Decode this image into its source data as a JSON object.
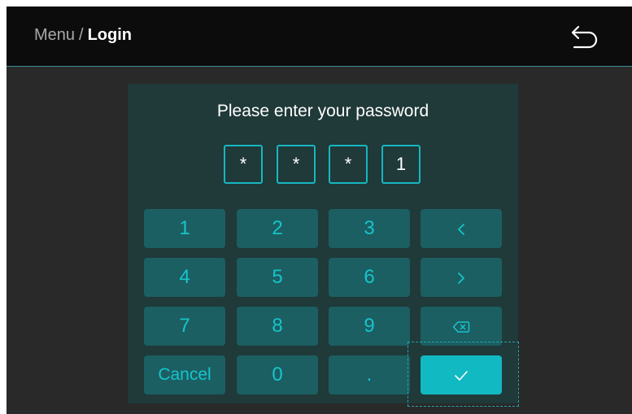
{
  "header": {
    "breadcrumb_parent": "Menu",
    "breadcrumb_separator": "/",
    "breadcrumb_current": "Login",
    "back_icon": "undo-arrow-icon"
  },
  "dialog": {
    "title": "Please enter your password",
    "password_digits": [
      "*",
      "*",
      "*",
      "1"
    ]
  },
  "keypad": {
    "k1": "1",
    "k2": "2",
    "k3": "3",
    "k4": "4",
    "k5": "5",
    "k6": "6",
    "k7": "7",
    "k8": "8",
    "k9": "9",
    "cancel": "Cancel",
    "k0": "0",
    "dot": ".",
    "left_icon": "chevron-left-icon",
    "right_icon": "chevron-right-icon",
    "backspace_icon": "backspace-icon",
    "confirm_icon": "checkmark-icon"
  },
  "colors": {
    "accent": "#17b7c1",
    "key_bg": "#1b5f62",
    "panel_bg": "#203939",
    "header_bg": "#0c0c0c",
    "screen_bg": "#292929"
  }
}
